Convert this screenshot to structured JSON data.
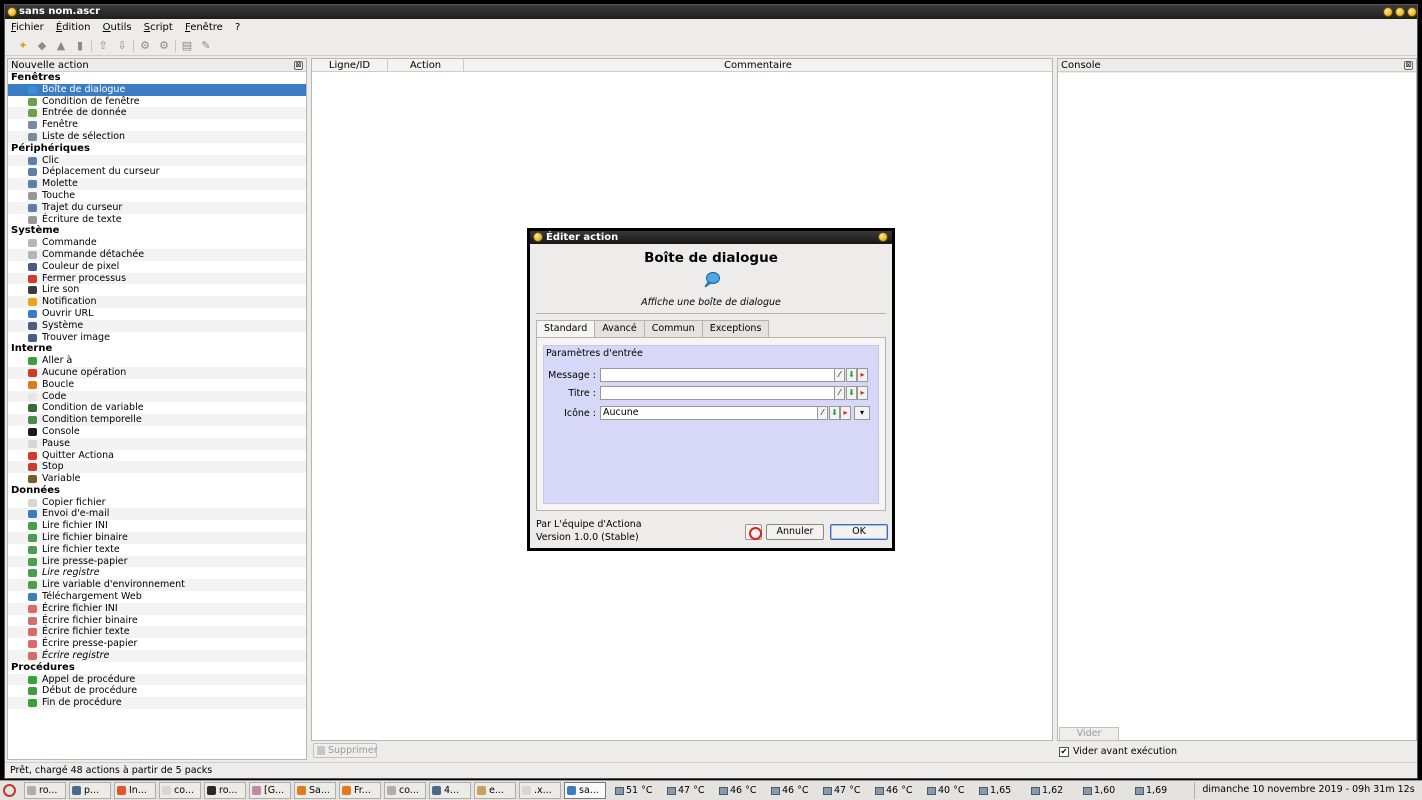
{
  "window": {
    "title": "sans nom.ascr"
  },
  "menu": [
    "Fichier",
    "Édition",
    "Outils",
    "Script",
    "Fenêtre",
    "?"
  ],
  "left_panel": {
    "title": "Nouvelle action",
    "categories": [
      {
        "name": "Fenêtres",
        "items": [
          {
            "label": "Boîte de dialogue",
            "icon": "dialog-icon",
            "color": "#3b8fd8",
            "selected": true
          },
          {
            "label": "Condition de fenêtre",
            "icon": "window-condition-icon",
            "color": "#6aa04a"
          },
          {
            "label": "Entrée de donnée",
            "icon": "input-icon",
            "color": "#6aa04a"
          },
          {
            "label": "Fenêtre",
            "icon": "window-icon",
            "color": "#7a8aa0"
          },
          {
            "label": "Liste de sélection",
            "icon": "list-icon",
            "color": "#7a8aa0"
          }
        ]
      },
      {
        "name": "Périphériques",
        "items": [
          {
            "label": "Clic",
            "icon": "mouse-icon",
            "color": "#5e7fa8"
          },
          {
            "label": "Déplacement du curseur",
            "icon": "cursor-move-icon",
            "color": "#5e7fa8"
          },
          {
            "label": "Molette",
            "icon": "wheel-icon",
            "color": "#5e7fa8"
          },
          {
            "label": "Touche",
            "icon": "key-icon",
            "color": "#9a9894"
          },
          {
            "label": "Trajet du curseur",
            "icon": "cursor-path-icon",
            "color": "#5e7fa8"
          },
          {
            "label": "Écriture de texte",
            "icon": "keyboard-icon",
            "color": "#9a9894"
          }
        ]
      },
      {
        "name": "Système",
        "items": [
          {
            "label": "Commande",
            "icon": "gear-icon",
            "color": "#b8b6b2"
          },
          {
            "label": "Commande détachée",
            "icon": "gear-detached-icon",
            "color": "#b8b6b2"
          },
          {
            "label": "Couleur de pixel",
            "icon": "pixel-icon",
            "color": "#4a5a8a"
          },
          {
            "label": "Fermer processus",
            "icon": "kill-icon",
            "color": "#d23a2a"
          },
          {
            "label": "Lire son",
            "icon": "sound-icon",
            "color": "#3a3a3a"
          },
          {
            "label": "Notification",
            "icon": "warning-icon",
            "color": "#e8a41a"
          },
          {
            "label": "Ouvrir URL",
            "icon": "globe-icon",
            "color": "#3a7dc4"
          },
          {
            "label": "Système",
            "icon": "computer-icon",
            "color": "#4a5a8a"
          },
          {
            "label": "Trouver image",
            "icon": "find-image-icon",
            "color": "#4a5a8a"
          }
        ]
      },
      {
        "name": "Interne",
        "items": [
          {
            "label": "Aller à",
            "icon": "goto-icon",
            "color": "#3aa03a"
          },
          {
            "label": "Aucune opération",
            "icon": "noop-icon",
            "color": "#d23a2a"
          },
          {
            "label": "Boucle",
            "icon": "loop-icon",
            "color": "#e07a1a"
          },
          {
            "label": "Code",
            "icon": "code-icon",
            "color": "#e8e6e2"
          },
          {
            "label": "Condition de variable",
            "icon": "variable-condition-icon",
            "color": "#3a6a3a"
          },
          {
            "label": "Condition temporelle",
            "icon": "clock-icon",
            "color": "#4a8a4a"
          },
          {
            "label": "Console",
            "icon": "console-icon",
            "color": "#1a1a1a"
          },
          {
            "label": "Pause",
            "icon": "pause-icon",
            "color": "#d8d6d2"
          },
          {
            "label": "Quitter Actiona",
            "icon": "exit-icon",
            "color": "#d23a2a"
          },
          {
            "label": "Stop",
            "icon": "stop-icon",
            "color": "#d23a2a"
          },
          {
            "label": "Variable",
            "icon": "variable-icon",
            "color": "#7a5a2a"
          }
        ]
      },
      {
        "name": "Données",
        "items": [
          {
            "label": "Copier fichier",
            "icon": "copy-file-icon",
            "color": "#d8d6d2"
          },
          {
            "label": "Envoi d'e-mail",
            "icon": "email-icon",
            "color": "#3a7dc4"
          },
          {
            "label": "Lire fichier INI",
            "icon": "read-ini-icon",
            "color": "#4aa04a"
          },
          {
            "label": "Lire fichier binaire",
            "icon": "read-binary-icon",
            "color": "#4aa04a"
          },
          {
            "label": "Lire fichier texte",
            "icon": "read-text-icon",
            "color": "#4aa04a"
          },
          {
            "label": "Lire presse-papier",
            "icon": "read-clipboard-icon",
            "color": "#4aa04a"
          },
          {
            "label": "Lire registre",
            "icon": "read-registry-icon",
            "color": "#4aa04a",
            "italic": true
          },
          {
            "label": "Lire variable d'environnement",
            "icon": "read-env-icon",
            "color": "#4aa04a"
          },
          {
            "label": "Téléchargement Web",
            "icon": "download-icon",
            "color": "#3a7dc4"
          },
          {
            "label": "Écrire fichier INI",
            "icon": "write-ini-icon",
            "color": "#d86a6a"
          },
          {
            "label": "Écrire fichier binaire",
            "icon": "write-binary-icon",
            "color": "#d86a6a"
          },
          {
            "label": "Écrire fichier texte",
            "icon": "write-text-icon",
            "color": "#d86a6a"
          },
          {
            "label": "Écrire presse-papier",
            "icon": "write-clipboard-icon",
            "color": "#d86a6a"
          },
          {
            "label": "Écrire registre",
            "icon": "write-registry-icon",
            "color": "#d86a6a",
            "italic": true
          }
        ]
      },
      {
        "name": "Procédures",
        "items": [
          {
            "label": "Appel de procédure",
            "icon": "call-procedure-icon",
            "color": "#3aa03a"
          },
          {
            "label": "Début de procédure",
            "icon": "begin-procedure-icon",
            "color": "#3aa03a"
          },
          {
            "label": "Fin de procédure",
            "icon": "end-procedure-icon",
            "color": "#3aa03a"
          }
        ]
      }
    ]
  },
  "script_table": {
    "columns": [
      "Ligne/ID",
      "Action",
      "Commentaire"
    ],
    "delete_label": "Supprimer"
  },
  "console_panel": {
    "title": "Console",
    "clear_label": "Vider",
    "clear_before_run_label": "Vider avant exécution",
    "clear_before_run_checked": true
  },
  "status": "Prêt, chargé 48 actions à partir de 5 packs",
  "dialog": {
    "title": "Éditer action",
    "heading": "Boîte de dialogue",
    "description": "Affiche une boîte de dialogue",
    "tabs": [
      "Standard",
      "Avancé",
      "Commun",
      "Exceptions"
    ],
    "active_tab": "Standard",
    "group_title": "Paramètres d'entrée",
    "fields": [
      {
        "label": "Message :",
        "value": ""
      },
      {
        "label": "Titre :",
        "value": ""
      },
      {
        "label": "Icône :",
        "value": "Aucune"
      }
    ],
    "author": "Par L'équipe d'Actiona",
    "version": "Version 1.0.0 (Stable)",
    "cancel_label": "Annuler",
    "ok_label": "OK"
  },
  "taskbar": {
    "tasks": [
      {
        "label": "ro...",
        "color": "#b0aeaa"
      },
      {
        "label": "p...",
        "color": "#4a6a8a"
      },
      {
        "label": "In...",
        "color": "#e0562a"
      },
      {
        "label": "co...",
        "color": "#d8d6d2"
      },
      {
        "label": "ro...",
        "color": "#2a2a2a"
      },
      {
        "label": "[G...",
        "color": "#c08aa0"
      },
      {
        "label": "Sa...",
        "color": "#e07a1a"
      },
      {
        "label": "Fr...",
        "color": "#e07a1a"
      },
      {
        "label": "co...",
        "color": "#b0aeaa"
      },
      {
        "label": "4...",
        "color": "#4a6a8a"
      },
      {
        "label": "e...",
        "color": "#c8a060"
      },
      {
        "label": ".x...",
        "color": "#d8d6d2"
      },
      {
        "label": "sa...",
        "color": "#3a7dc4",
        "active": true
      }
    ],
    "tray": [
      "51 °C",
      "47 °C",
      "46 °C",
      "46 °C",
      "47 °C",
      "46 °C",
      "40 °C",
      "1,65",
      "1,62",
      "1,60",
      "1,69"
    ],
    "clock": "dimanche 10 novembre 2019 - 09h 31m 12s"
  },
  "colors": {
    "selection": "#3a7dc4",
    "param_group": "#d7d8f7"
  }
}
